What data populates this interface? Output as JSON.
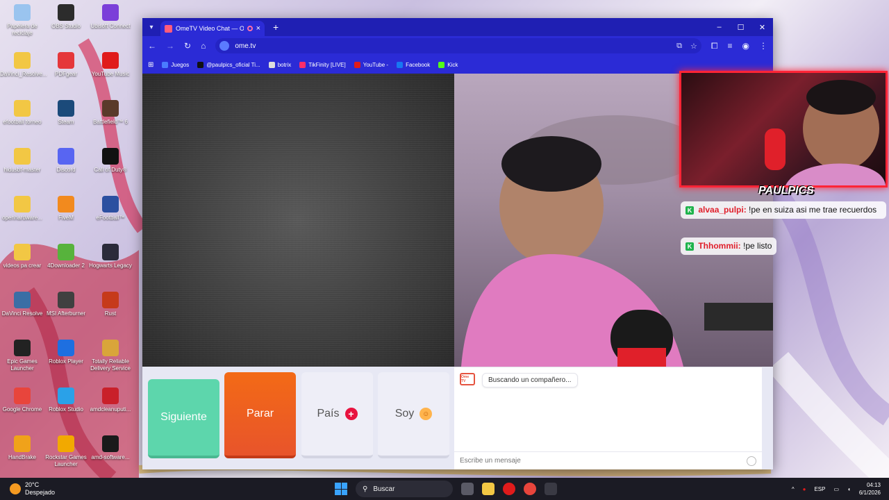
{
  "desktop": {
    "icons": [
      {
        "label": "Papelera de reciclaje",
        "color": "#9ac4ef"
      },
      {
        "label": "OBS Studio",
        "color": "#2c2c2c"
      },
      {
        "label": "Ubisoft Connect",
        "color": "#7b3fd9"
      },
      {
        "label": "DaVinci_Resolve...",
        "color": "#f2c744"
      },
      {
        "label": "PDFgear",
        "color": "#e5363a"
      },
      {
        "label": "YouTube Music",
        "color": "#e01b1b"
      },
      {
        "label": "efootball torneo",
        "color": "#f2c744"
      },
      {
        "label": "Steam",
        "color": "#1b4a7a"
      },
      {
        "label": "Battlefield™ 6",
        "color": "#5a3a2a"
      },
      {
        "label": "hidusbf-master",
        "color": "#f2c744"
      },
      {
        "label": "Discord",
        "color": "#5865f2"
      },
      {
        "label": "Call of Duty®",
        "color": "#111111"
      },
      {
        "label": "openhardware...",
        "color": "#f2c744"
      },
      {
        "label": "FiveM",
        "color": "#f28a1e"
      },
      {
        "label": "eFootball™",
        "color": "#2b4fa0"
      },
      {
        "label": "videos pa crear",
        "color": "#f2c744"
      },
      {
        "label": "4Downloader 2",
        "color": "#57b33c"
      },
      {
        "label": "Hogwarts Legacy",
        "color": "#2b2b3a"
      },
      {
        "label": "DaVinci Resolve",
        "color": "#3a6ea5"
      },
      {
        "label": "MSI Afterburner",
        "color": "#404040"
      },
      {
        "label": "Rust",
        "color": "#c63a1a"
      },
      {
        "label": "Epic Games Launcher",
        "color": "#222222"
      },
      {
        "label": "Roblox Player",
        "color": "#1e6fe0"
      },
      {
        "label": "Totally Reliable Delivery Service",
        "color": "#d9a53a"
      },
      {
        "label": "Google Chrome",
        "color": "#e8453c"
      },
      {
        "label": "Roblox Studio",
        "color": "#2aa1e8"
      },
      {
        "label": "amdcleanuputi...",
        "color": "#c9202a"
      },
      {
        "label": "HandBrake",
        "color": "#f0a21a"
      },
      {
        "label": "Rockstar Games Launcher",
        "color": "#f2a900"
      },
      {
        "label": "amd-software...",
        "color": "#1a1a1a"
      }
    ]
  },
  "browser": {
    "tab_title": "OmeTV Video Chat — Ome",
    "tab_close": "×",
    "new_tab": "+",
    "url": "ome.tv",
    "win_controls": {
      "minimize": "–",
      "maximize": "☐",
      "close": "✕"
    },
    "nav": {
      "back": "←",
      "forward": "→",
      "reload": "↻",
      "home": "⌂"
    },
    "bookmarks": [
      {
        "label": "Juegos",
        "color": "#4a7bff"
      },
      {
        "label": "@paulpics_oficial Ti...",
        "color": "#111111"
      },
      {
        "label": "botrix",
        "color": "#dddddd"
      },
      {
        "label": "TikFinity [LIVE]",
        "color": "#ff2d6b"
      },
      {
        "label": "YouTube -",
        "color": "#e01b1b"
      },
      {
        "label": "Facebook",
        "color": "#1877f2"
      },
      {
        "label": "Kick",
        "color": "#53fc18"
      }
    ]
  },
  "ometv": {
    "buttons": {
      "next": "Siguiente",
      "stop": "Parar",
      "country": "País",
      "gender": "Soy"
    },
    "chat": {
      "logo": "Ome TV",
      "status": "Buscando un compañero...",
      "placeholder": "Escribe un mensaje"
    }
  },
  "stream_overlay": {
    "logo": "PAULPICS",
    "messages": [
      {
        "user": "alvaa_pulpi:",
        "text": "!pe en suiza asi me trae recuerdos"
      },
      {
        "user": "Thhommii:",
        "text": "!pe listo"
      }
    ]
  },
  "taskbar": {
    "weather_temp": "20°C",
    "weather_text": "Despejado",
    "search": "Buscar",
    "language": "ESP",
    "time": "04:13",
    "date": "6/1/2026"
  }
}
